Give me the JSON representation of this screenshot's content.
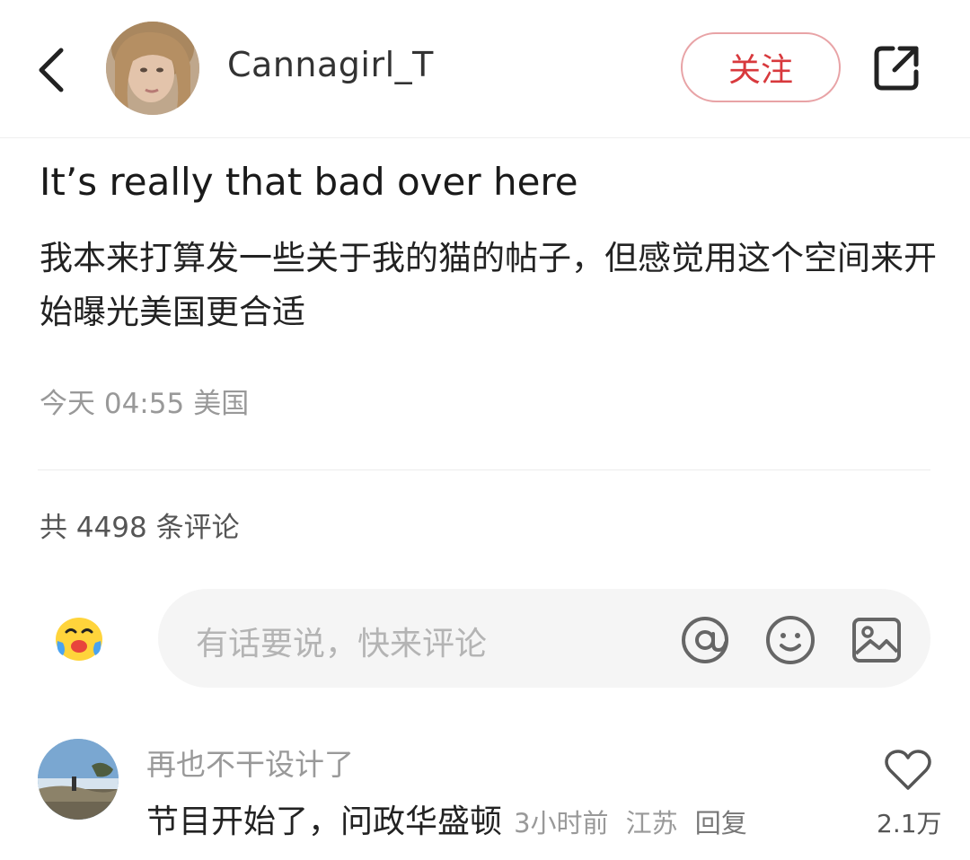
{
  "header": {
    "back_icon": "chevron-left-icon",
    "username": "Cannagirl_T",
    "follow_label": "关注",
    "share_icon": "share-external-icon",
    "accent_color": "#d8393d"
  },
  "post": {
    "title": "It’s really that bad over here",
    "body": "我本来打算发一些关于我的猫的帖子，但感觉用这个空间来开始曝光美国更合适",
    "time": "今天 04:55",
    "location": "美国"
  },
  "comments": {
    "count_text": "共 4498 条评论",
    "input_placeholder": "有话要说，快来评论",
    "input_icons": [
      "at-icon",
      "emoji-smile-icon",
      "image-icon"
    ],
    "items": [
      {
        "author": "再也不干设计了",
        "text": "节目开始了，问政华盛顿",
        "time": "3小时前",
        "location": "江苏",
        "reply_label": "回复",
        "likes": "2.1万"
      }
    ]
  }
}
